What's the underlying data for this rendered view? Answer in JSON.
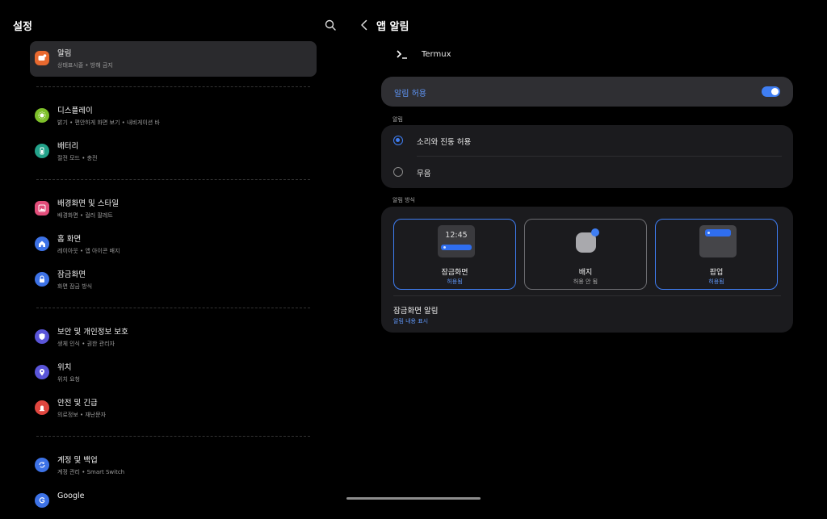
{
  "left": {
    "title": "설정",
    "items": [
      {
        "label": "알림",
        "sub": "상태표시줄 • 방해 금지",
        "icon": "bell-icon",
        "color": "#e8692f"
      },
      {
        "label": "디스플레이",
        "sub": "밝기 • 편안하게 화면 보기 • 내비게이션 바",
        "icon": "sun-icon",
        "color": "#7ec02a"
      },
      {
        "label": "배터리",
        "sub": "절전 모드 • 충전",
        "icon": "battery-icon",
        "color": "#23a28a"
      },
      {
        "label": "배경화면 및 스타일",
        "sub": "배경화면 • 컬러 팔레트",
        "icon": "image-icon",
        "color": "#e24d7a"
      },
      {
        "label": "홈 화면",
        "sub": "레이아웃 • 앱 아이콘 배지",
        "icon": "home-icon",
        "color": "#3d72e6"
      },
      {
        "label": "잠금화면",
        "sub": "화면 잠금 방식",
        "icon": "lock-icon",
        "color": "#3d72e6"
      },
      {
        "label": "보안 및 개인정보 보호",
        "sub": "생체 인식 • 권한 관리자",
        "icon": "shield-icon",
        "color": "#5a55d9"
      },
      {
        "label": "위치",
        "sub": "위치 요청",
        "icon": "location-icon",
        "color": "#5a55d9"
      },
      {
        "label": "안전 및 긴급",
        "sub": "의료정보 • 재난문자",
        "icon": "alert-icon",
        "color": "#e0463f"
      },
      {
        "label": "계정 및 백업",
        "sub": "계정 관리 • Smart Switch",
        "icon": "sync-icon",
        "color": "#3d72e6"
      },
      {
        "label": "Google",
        "sub": "",
        "icon": "google-icon",
        "color": "#3d72e6"
      }
    ]
  },
  "right": {
    "title": "앱 알림",
    "app_name": "Termux",
    "allow_label": "알림 허용",
    "allow_enabled": true,
    "alerts_section": "알림",
    "radio_options": [
      {
        "label": "소리와 진동 허용",
        "selected": true
      },
      {
        "label": "무음",
        "selected": false
      }
    ],
    "style_section": "알림 방식",
    "styles": [
      {
        "label": "잠금화면",
        "status": "허용됨",
        "preview_time": "12:45"
      },
      {
        "label": "배지",
        "status": "허용 안 됨"
      },
      {
        "label": "팝업",
        "status": "허용됨"
      }
    ],
    "lock_notif_title": "잠금화면 알림",
    "lock_notif_sub": "알림 내용 표시"
  },
  "colors": {
    "accent": "#3f7ef3",
    "link": "#5f96f7",
    "card": "#1b1b1e"
  }
}
